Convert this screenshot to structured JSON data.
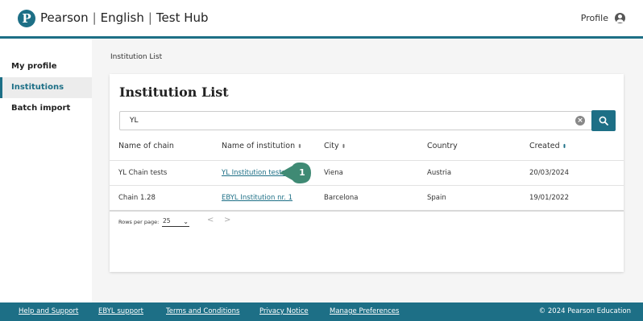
{
  "header": {
    "logo_letter": "P",
    "brand_name": "Pearson",
    "brand_product": "English",
    "brand_app": "Test Hub",
    "profile_label": "Profile"
  },
  "sidebar": {
    "items": [
      {
        "label": "My profile",
        "active": false
      },
      {
        "label": "Institutions",
        "active": true
      },
      {
        "label": "Batch import",
        "active": false
      }
    ]
  },
  "breadcrumb": "Institution List",
  "card": {
    "title": "Institution List",
    "search": {
      "value": "YL"
    },
    "columns": [
      "Name of chain",
      "Name of institution",
      "City",
      "Country",
      "Created"
    ],
    "rows": [
      {
        "chain": "YL Chain tests",
        "institution": "YL Institution tests",
        "city": "Viena",
        "country": "Austria",
        "created": "20/03/2024"
      },
      {
        "chain": "Chain 1.28",
        "institution": "EBYL Institution nr. 1",
        "city": "Barcelona",
        "country": "Spain",
        "created": "19/01/2022"
      }
    ],
    "pagination": {
      "rows_per_page_label": "Rows per page:",
      "rows_per_page_value": "25",
      "prev": "<",
      "next": ">"
    }
  },
  "callout": {
    "number": "1"
  },
  "footer": {
    "links": [
      "Help and Support",
      "EBYL support",
      "Terms and Conditions",
      "Privacy Notice",
      "Manage Preferences"
    ],
    "copyright": "© 2024 Pearson Education"
  },
  "colors": {
    "accent": "#1d6f86",
    "callout": "#3f8a74"
  }
}
